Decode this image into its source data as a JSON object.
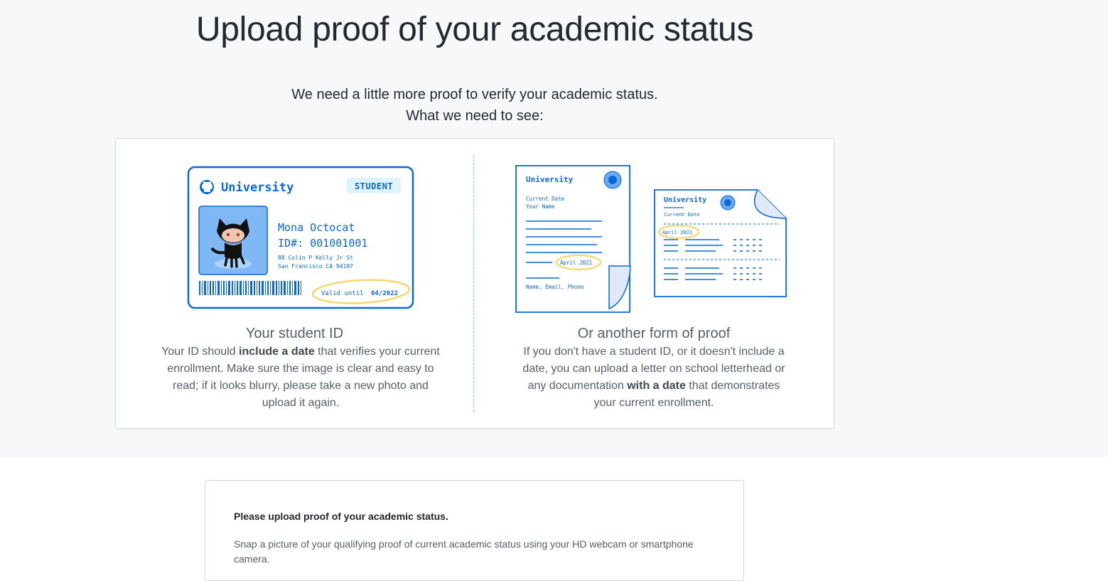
{
  "header": {
    "title": "Upload proof of your academic status",
    "subtitle_line1": "We need a little more proof to verify your academic status.",
    "subtitle_line2": "What we need to see:"
  },
  "student_id": {
    "illustration": {
      "university": "University",
      "badge": "STUDENT",
      "name": "Mona Octocat",
      "id": "ID#: 001001001",
      "address_line1": "88 Colin P Kelly Jr St",
      "address_line2": "San Francisco CA 94107",
      "valid_label": "Valid until",
      "valid_date": "04/2022"
    },
    "heading": "Your student ID",
    "desc_before": "Your ID should ",
    "desc_bold": "include a date",
    "desc_after": " that verifies your current enrollment. Make sure the image is clear and easy to read; if it looks blurry, please take a new photo and upload it again."
  },
  "other_proof": {
    "illustration": {
      "university": "University",
      "current_date": "Current Date",
      "your_name": "Your Name",
      "date": "April 2021",
      "contact": "Name, Email, Phone"
    },
    "heading": "Or another form of proof",
    "desc_before": "If you don't have a student ID, or it doesn't include a date, you can upload a letter on school letterhead or any documentation ",
    "desc_bold": "with a date",
    "desc_after": " that demonstrates your current enrollment."
  },
  "upload": {
    "heading": "Please upload proof of your academic status.",
    "description": "Snap a picture of your qualifying proof of current academic status using your HD webcam or smartphone camera."
  },
  "colors": {
    "primary_blue": "#0969da",
    "light_blue": "#ddf4ff",
    "highlight_yellow": "#f5d76e",
    "background": "#f6f8fa"
  }
}
